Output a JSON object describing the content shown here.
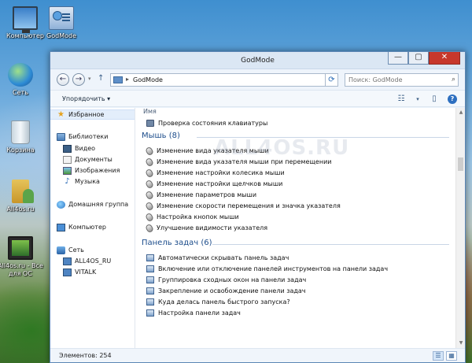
{
  "desktop": {
    "icons": [
      {
        "label": "Компьютер"
      },
      {
        "label": "GodMode"
      },
      {
        "label": "Сеть"
      },
      {
        "label": "Корзина"
      },
      {
        "label": "All4os.ru"
      },
      {
        "label": "All4os.ru - Все для ОС"
      }
    ]
  },
  "window": {
    "title": "GodMode",
    "controls": {
      "minimize": "—",
      "maximize": "▢",
      "close": "✕"
    },
    "address": {
      "path": "GodMode",
      "separator": "▸"
    },
    "search": {
      "placeholder": "Поиск: GodMode"
    },
    "toolbar": {
      "organize": "Упорядочить ▾"
    },
    "status": "Элементов: 254"
  },
  "navpane": {
    "favorites": "Избранное",
    "libraries": "Библиотеки",
    "lib_items": [
      "Видео",
      "Документы",
      "Изображения",
      "Музыка"
    ],
    "homegroup": "Домашняя группа",
    "computer": "Компьютер",
    "network": "Сеть",
    "network_items": [
      "ALL4OS_RU",
      "VITALK"
    ]
  },
  "list": {
    "column_name": "Имя",
    "top_item": "Проверка состояния клавиатуры",
    "groups": [
      {
        "title": "Мышь (8)",
        "items": [
          "Изменение вида указателя мыши",
          "Изменение вида указателя мыши при перемещении",
          "Изменение настройки колесика мыши",
          "Изменение настройки щелчков мыши",
          "Изменение параметров мыши",
          "Изменение скорости перемещения и значка указателя",
          "Настройка кнопок мыши",
          "Улучшение видимости указателя"
        ]
      },
      {
        "title": "Панель задач (6)",
        "items": [
          "Автоматически скрывать панель задач",
          "Включение или отключение панелей инструментов на панели задач",
          "Группировка сходных окон на панели задач",
          "Закрепление и освобождение панели задач",
          "Куда делась панель быстрого запуска?",
          "Настройка панели задач"
        ]
      }
    ]
  },
  "watermark": "ALL4OS.RU"
}
